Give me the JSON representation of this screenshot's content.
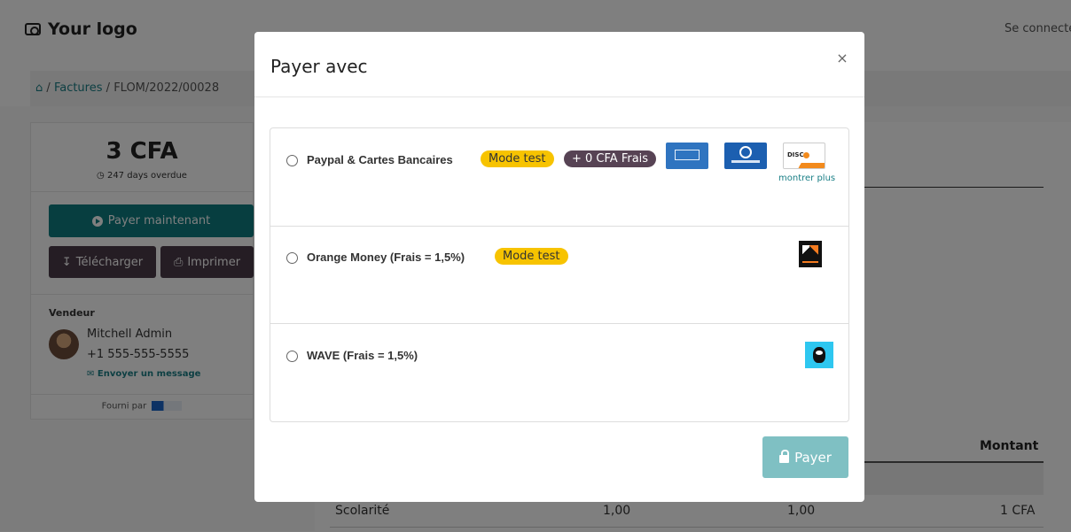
{
  "header": {
    "logo": "Your logo",
    "connect": "Se connecte"
  },
  "breadcrumb": {
    "sep1": "/",
    "link": "Factures",
    "sep2": "/",
    "current": "FLOM/2022/00028"
  },
  "sidebar": {
    "amount": "3 CFA",
    "overdue": "247 days overdue",
    "pay_now": "Payer maintenant",
    "download": "Télécharger",
    "print": "Imprimer",
    "vendor_label": "Vendeur",
    "vendor_name": "Mitchell Admin",
    "vendor_phone": "+1 555-555-5555",
    "send_message": "Envoyer un message",
    "provided_by": "Fourni par"
  },
  "table": {
    "header_amount": "Montant",
    "row": {
      "name": "Scolarité",
      "qty1": "1,00",
      "qty2": "1,00",
      "amount": "1 CFA"
    }
  },
  "modal": {
    "title": "Payer avec",
    "close": "×",
    "options": [
      {
        "label": "Paypal & Cartes Bancaires",
        "badge_test": "Mode test",
        "badge_fee": "+ 0 CFA Frais",
        "more": "montrer plus"
      },
      {
        "label": "Orange Money (Frais = 1,5%)",
        "badge_test": "Mode test"
      },
      {
        "label": "WAVE (Frais = 1,5%)"
      }
    ],
    "submit": "Payer"
  }
}
